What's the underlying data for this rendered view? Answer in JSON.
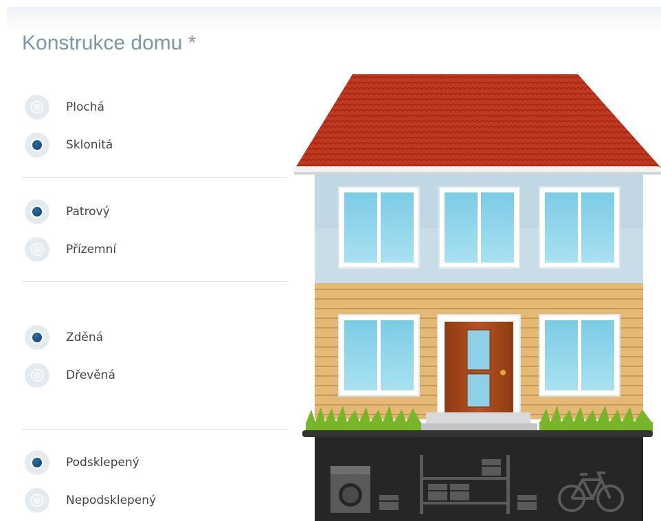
{
  "title": "Konstrukce domu *",
  "groups": [
    {
      "name": "roof",
      "options": [
        {
          "label": "Plochá",
          "selected": false
        },
        {
          "label": "Sklonitá",
          "selected": true
        }
      ]
    },
    {
      "name": "floors",
      "options": [
        {
          "label": "Patrový",
          "selected": true
        },
        {
          "label": "Přízemní",
          "selected": false
        }
      ]
    },
    {
      "name": "material",
      "options": [
        {
          "label": "Zděná",
          "selected": true
        },
        {
          "label": "Dřevěná",
          "selected": false
        }
      ]
    },
    {
      "name": "basement",
      "options": [
        {
          "label": "Podsklepený",
          "selected": true
        },
        {
          "label": "Nepodsklepený",
          "selected": false
        }
      ]
    }
  ],
  "colors": {
    "title": "#7c97ab",
    "radio_selected": "#0c3c68",
    "roof": "#c2371f",
    "upper_wall": "#c9dde8",
    "lower_wall": "#e5b875",
    "door": "#a84a1c",
    "window_glass": "#8dd3ea",
    "grass": "#79b52b",
    "basement": "#262626"
  },
  "house_icons": [
    "roof-image",
    "window-icon",
    "door-icon",
    "grass-image",
    "stairs-image",
    "washing-machine-icon",
    "box-icon",
    "shelf-icon",
    "bicycle-icon"
  ]
}
